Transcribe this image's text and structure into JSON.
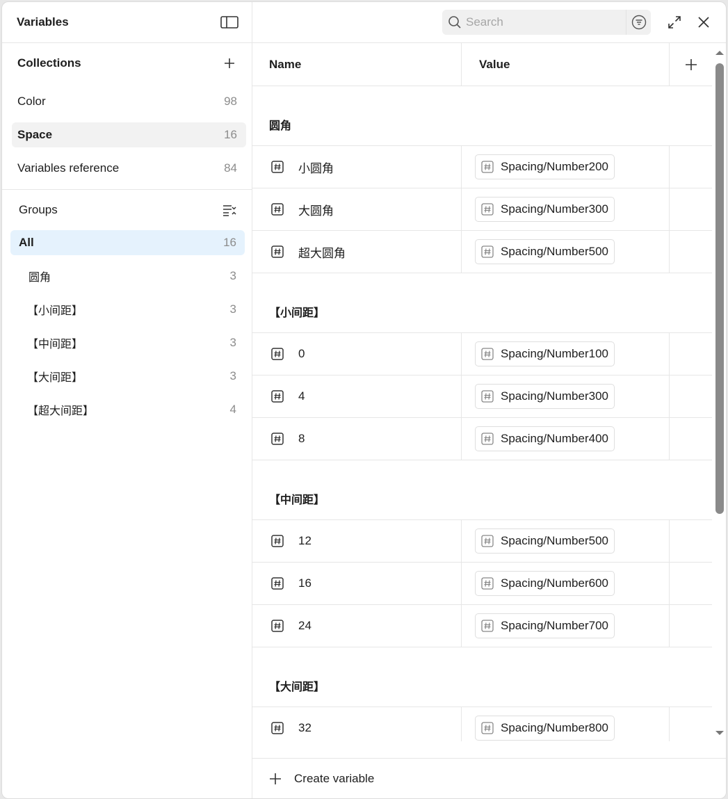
{
  "panel": {
    "title": "Variables"
  },
  "collections": {
    "title": "Collections",
    "items": [
      {
        "label": "Color",
        "count": "98"
      },
      {
        "label": "Space",
        "count": "16",
        "selected": true
      },
      {
        "label": "Variables reference",
        "count": "84"
      }
    ]
  },
  "groups": {
    "title": "Groups",
    "items": [
      {
        "label": "All",
        "count": "16"
      },
      {
        "label": "圆角",
        "count": "3"
      },
      {
        "label": "【小间距】",
        "count": "3"
      },
      {
        "label": "【中间距】",
        "count": "3"
      },
      {
        "label": "【大间距】",
        "count": "3"
      },
      {
        "label": "【超大间距】",
        "count": "4"
      }
    ]
  },
  "search": {
    "placeholder": "Search",
    "value": ""
  },
  "table": {
    "columns": {
      "name": "Name",
      "value": "Value"
    },
    "groups": [
      {
        "title": "圆角",
        "rows": [
          {
            "name": "小圆角",
            "value": "Spacing/Number200"
          },
          {
            "name": "大圆角",
            "value": "Spacing/Number300"
          },
          {
            "name": "超大圆角",
            "value": "Spacing/Number500"
          }
        ]
      },
      {
        "title": "【小间距】",
        "rows": [
          {
            "name": "0",
            "value": "Spacing/Number100"
          },
          {
            "name": "4",
            "value": "Spacing/Number300"
          },
          {
            "name": "8",
            "value": "Spacing/Number400"
          }
        ]
      },
      {
        "title": "【中间距】",
        "rows": [
          {
            "name": "12",
            "value": "Spacing/Number500"
          },
          {
            "name": "16",
            "value": "Spacing/Number600"
          },
          {
            "name": "24",
            "value": "Spacing/Number700"
          }
        ]
      },
      {
        "title": "【大间距】",
        "rows": [
          {
            "name": "32",
            "value": "Spacing/Number800"
          }
        ]
      }
    ]
  },
  "footer": {
    "create_label": "Create variable"
  },
  "icons": {
    "sidebar_toggle": "sidebar-toggle-icon",
    "add": "plus-icon",
    "sort": "sort-icon",
    "search": "search-icon",
    "filter": "filter-icon",
    "expand": "expand-icon",
    "close": "close-icon",
    "number_variable": "hash-icon"
  },
  "colors": {
    "selected_group_bg": "#e5f2fd",
    "selected_collection_bg": "#f2f2f2",
    "scroll_thumb": "#8a8a8a"
  }
}
